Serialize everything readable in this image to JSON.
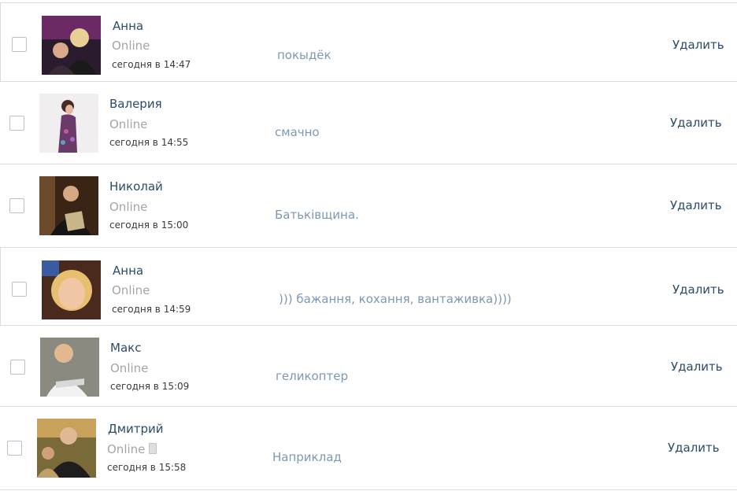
{
  "dialogs": [
    {
      "name": "Анна",
      "status": "Online",
      "time": "сегодня в 14:47",
      "message": "покыдёк",
      "delete_label": "Удалить"
    },
    {
      "name": "Валерия",
      "status": "Online",
      "time": "сегодня в 14:55",
      "message": "смачно",
      "delete_label": "Удалить"
    },
    {
      "name": "Николай",
      "status": "Online",
      "time": "сегодня в 15:00",
      "message": "Батьківщина.",
      "delete_label": "Удалить"
    },
    {
      "name": "Анна",
      "status": "Online",
      "time": "сегодня в 14:59",
      "message": "))) бажання, кохання, вантаживка))))",
      "delete_label": "Удалить"
    },
    {
      "name": "Макс",
      "status": "Online",
      "time": "сегодня в 15:09",
      "message": "геликоптер",
      "delete_label": "Удалить"
    },
    {
      "name": "Дмитрий",
      "status": "Online",
      "time": "сегодня в 15:58",
      "message": "Наприклад",
      "delete_label": "Удалить",
      "mobile_icon": "phone-icon"
    }
  ]
}
